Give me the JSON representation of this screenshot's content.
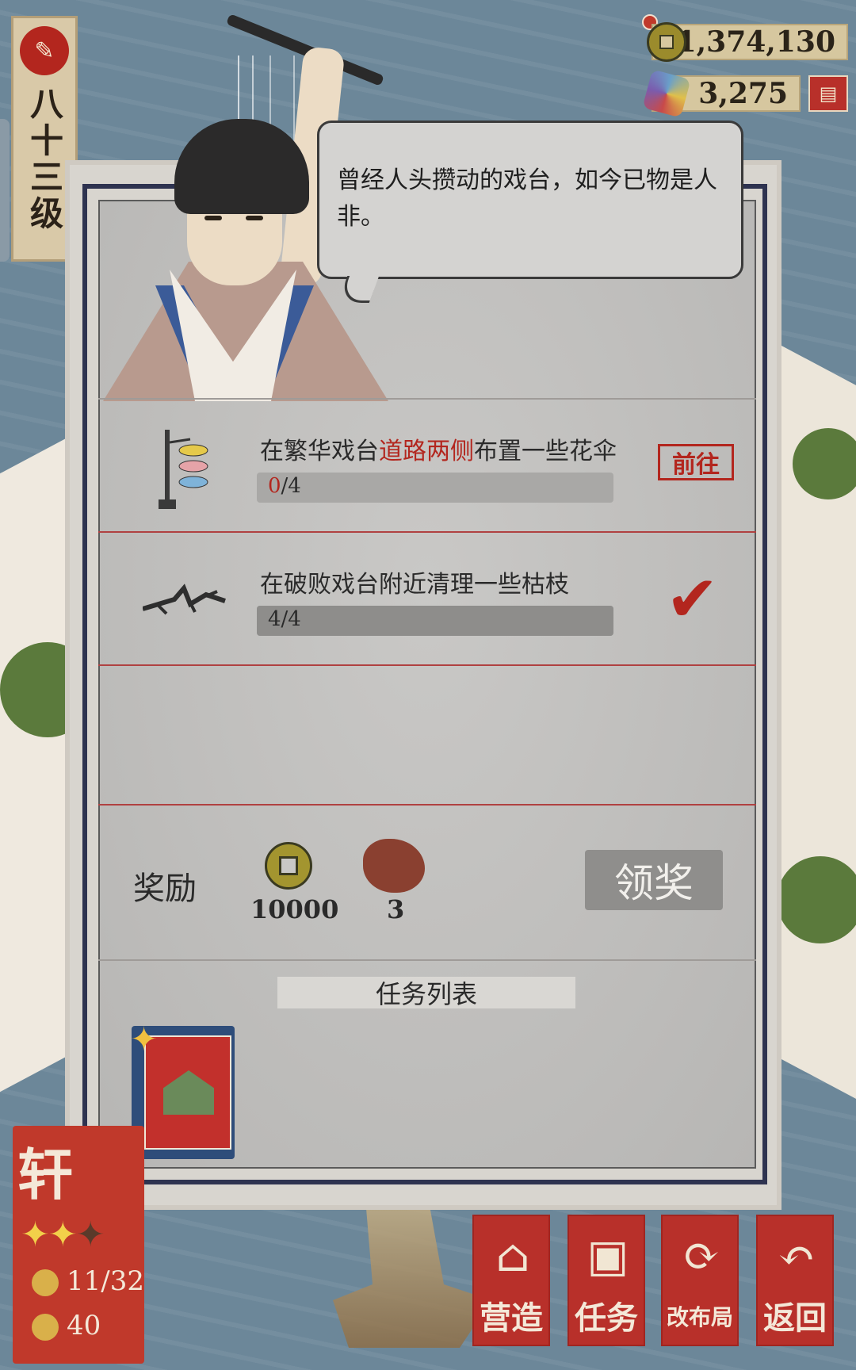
{
  "level": {
    "text": "八十三级"
  },
  "currencies": {
    "coins": "11,374,130",
    "jade": "3,275"
  },
  "dialog": {
    "text": "曾经人头攒动的戏台，如今已物是人非。"
  },
  "tasks": [
    {
      "title_prefix": "在繁华戏台",
      "title_highlight": "道路两侧",
      "title_suffix": "布置一些花伞",
      "progress_current": "0",
      "progress_total": "/4",
      "progress_fraction": 0,
      "action_label": "前往",
      "completed": false
    },
    {
      "title": "在破败戏台附近清理一些枯枝",
      "progress_text": "4/4",
      "progress_fraction": 1,
      "completed": true
    }
  ],
  "reward": {
    "label": "奖励",
    "items": [
      {
        "icon": "copper-coin-icon",
        "value": "10000"
      },
      {
        "icon": "ore-icon",
        "value": "3"
      }
    ],
    "claim_label": "领奖"
  },
  "task_list": {
    "title": "任务列表"
  },
  "city": {
    "name": "轩",
    "stars_filled": 2,
    "stars_total": 3,
    "population": "11/32",
    "happiness": "40"
  },
  "nav": [
    {
      "label": "营造",
      "icon": "building-icon"
    },
    {
      "label": "任务",
      "icon": "task-book-icon"
    },
    {
      "label": "改布局",
      "icon": "layout-icon"
    },
    {
      "label": "返回",
      "icon": "return-arrow-icon"
    }
  ],
  "colors": {
    "accent_red": "#b3261e",
    "panel_bg": "#c9c8c6",
    "frame_navy": "#2e3350"
  }
}
